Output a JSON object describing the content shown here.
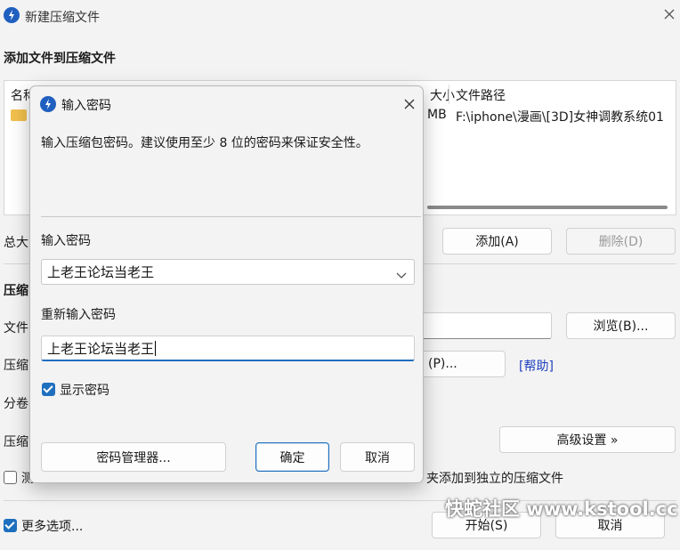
{
  "main_window": {
    "title": "新建压缩文件",
    "section_title": "添加文件到压缩文件",
    "file_table": {
      "columns": [
        "名称",
        "大小",
        "文件路径"
      ],
      "rows": [
        {
          "name": "",
          "size": "MB",
          "path": "F:\\iphone\\漫画\\[3D]女神调教系统01"
        }
      ]
    },
    "total_label": "总大",
    "add_button": "添加(A)",
    "delete_button": "删除(D)",
    "compress_section": "压缩",
    "file_label": "文件",
    "browse_button": "浏览(B)...",
    "compress_label": "压缩",
    "p_button": "(P)...",
    "help_link": "[帮助]",
    "split_label": "分卷",
    "compress_label2": "压缩",
    "advanced_button": "高级设置 »",
    "test_checkbox_label": "测",
    "separate_label": "夹添加到独立的压缩文件",
    "more_options_label": "更多选项...",
    "start_button": "开始(S)",
    "cancel_button": "取消",
    "watermark": "快蛇社区 www.kstool.cc"
  },
  "dialog": {
    "title": "输入密码",
    "description": "输入压缩包密码。建议使用至少 8 位的密码来保证安全性。",
    "password_label": "输入密码",
    "password_value": "上老王论坛当老王",
    "reenter_label": "重新输入密码",
    "reenter_value": "上老王论坛当老王",
    "show_password_label": "显示密码",
    "manager_button": "密码管理器...",
    "ok_button": "确定",
    "cancel_button": "取消"
  },
  "colors": {
    "accent": "#1f6fbf",
    "link": "#1d3fbf",
    "window_bg": "#f3f3f3"
  }
}
